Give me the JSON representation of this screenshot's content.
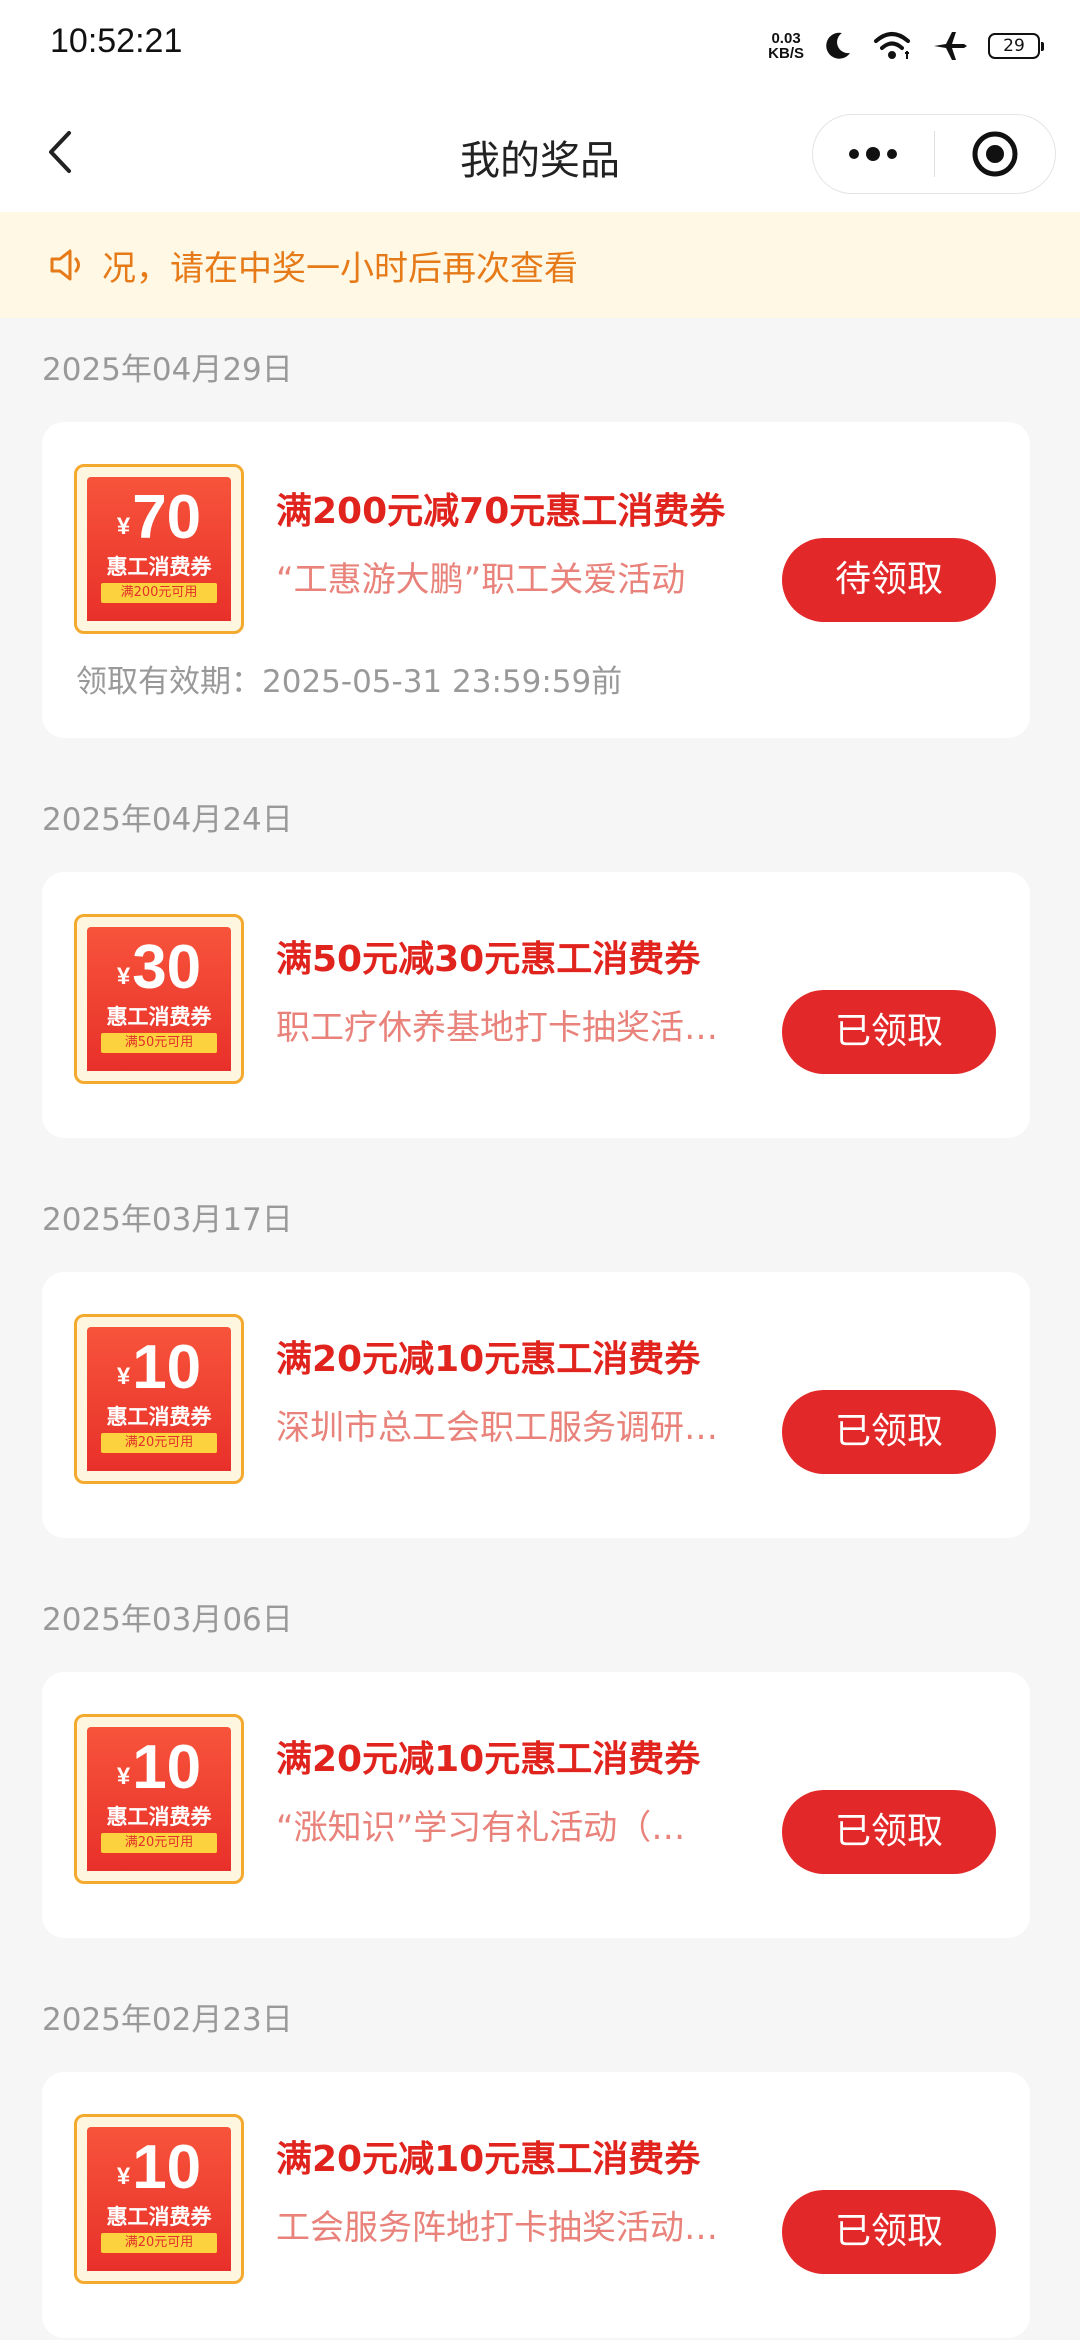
{
  "status_bar": {
    "time": "10:52:21",
    "net_speed_value": "0.03",
    "net_speed_unit": "KB/S",
    "battery": "29"
  },
  "nav": {
    "title": "我的奖品"
  },
  "notice": {
    "text": "况，请在中奖一小时后再次查看"
  },
  "prizes": [
    {
      "date": "2025年04月29日",
      "coupon_value": "70",
      "coupon_name": "惠工消费券",
      "coupon_condition": "满200元可用",
      "title": "满200元减70元惠工消费券",
      "source": "“工惠游大鹏”职工关爱活动",
      "button": "待领取",
      "validity": "领取有效期：2025-05-31 23:59:59前"
    },
    {
      "date": "2025年04月24日",
      "coupon_value": "30",
      "coupon_name": "惠工消费券",
      "coupon_condition": "满50元可用",
      "title": "满50元减30元惠工消费券",
      "source": "职工疗休养基地打卡抽奖活…",
      "button": "已领取"
    },
    {
      "date": "2025年03月17日",
      "coupon_value": "10",
      "coupon_name": "惠工消费券",
      "coupon_condition": "满20元可用",
      "title": "满20元减10元惠工消费券",
      "source": "深圳市总工会职工服务调研…",
      "button": "已领取"
    },
    {
      "date": "2025年03月06日",
      "coupon_value": "10",
      "coupon_name": "惠工消费券",
      "coupon_condition": "满20元可用",
      "title": "满20元减10元惠工消费券",
      "source": "“涨知识”学习有礼活动（…",
      "button": "已领取"
    },
    {
      "date": "2025年02月23日",
      "coupon_value": "10",
      "coupon_name": "惠工消费券",
      "coupon_condition": "满20元可用",
      "title": "满20元减10元惠工消费券",
      "source": "工会服务阵地打卡抽奖活动…",
      "button": "已领取"
    }
  ],
  "coupon_currency_symbol": "¥",
  "colors": {
    "accent_red": "#e3282a",
    "notice_bg": "#fef8e4",
    "notice_text": "#e67a19",
    "coupon_border": "#f4a92f"
  },
  "icons": {
    "back": "chevron-left-icon",
    "more": "more-dots-icon",
    "close": "target-circle-icon",
    "notice": "speaker-icon"
  }
}
